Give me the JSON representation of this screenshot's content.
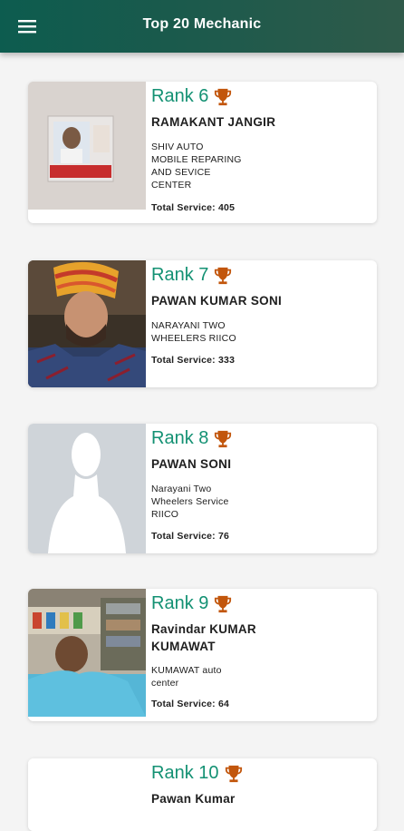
{
  "appbar": {
    "title": "Top 20 Mechanic",
    "menu_icon": "hamburger-menu-icon"
  },
  "accent_color": "#139173",
  "trophy_color": "#c2560c",
  "mechanics": [
    {
      "rank": "Rank 6",
      "name": "RAMAKANT JANGIR",
      "shop": "SHIV AUTO\nMOBILE REPARING\nAND SEVICE\nCENTER",
      "service": "Total Service: 405",
      "photo": "id-card-photo"
    },
    {
      "rank": "Rank 7",
      "name": "PAWAN KUMAR SONI",
      "shop": "NARAYANI TWO\nWHEELERS RIICO",
      "service": "Total Service: 333",
      "photo": "man-with-turban-photo"
    },
    {
      "rank": "Rank 8",
      "name": "PAWAN SONI",
      "shop": "Narayani Two\nWheelers Service\nRIICO",
      "service": "Total Service: 76",
      "photo": "default-avatar-silhouette"
    },
    {
      "rank": "Rank 9",
      "name": "Ravindar KUMAR\nKUMAWAT",
      "shop": "KUMAWAT auto\ncenter",
      "service": "Total Service: 64",
      "photo": "man-in-shop-photo"
    },
    {
      "rank": "Rank 10",
      "name": "Pawan Kumar",
      "shop": "",
      "service": "",
      "photo": ""
    }
  ]
}
